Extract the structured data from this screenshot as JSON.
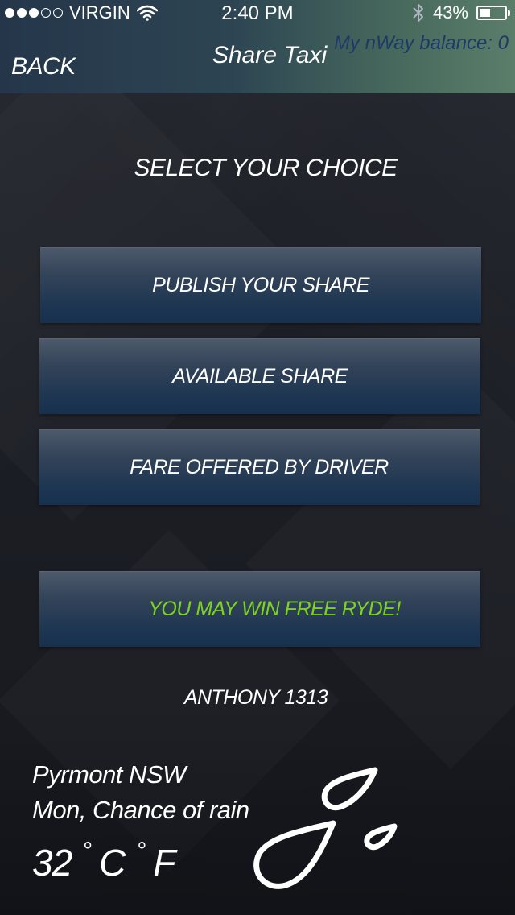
{
  "status_bar": {
    "carrier": "VIRGIN",
    "time": "2:40 PM",
    "battery_percent": "43%",
    "battery_level": 0.43,
    "signal_filled": 3,
    "signal_total": 5,
    "icons": [
      "wifi-icon",
      "bluetooth-icon",
      "battery-icon"
    ]
  },
  "nav": {
    "back_label": "BACK",
    "title": "Share Taxi",
    "balance": "My nWay balance:  0"
  },
  "main": {
    "section_title": "SELECT YOUR CHOICE",
    "choices": [
      "PUBLISH YOUR SHARE",
      "AVAILABLE SHARE",
      "FARE OFFERED BY DRIVER"
    ],
    "promo": "YOU MAY WIN FREE RYDE!",
    "username": "ANTHONY 1313"
  },
  "weather": {
    "location": "Pyrmont  NSW",
    "forecast": "Mon, Chance of rain",
    "temperature": "32",
    "unit_c": "C",
    "unit_f": "F",
    "degree_symbol": "°",
    "icon": "rain-drops-icon"
  },
  "colors": {
    "promo_text": "#7ed321",
    "balance_text": "#1d3a66",
    "button_top": "#4d5a6c",
    "button_bottom": "#16304e"
  }
}
